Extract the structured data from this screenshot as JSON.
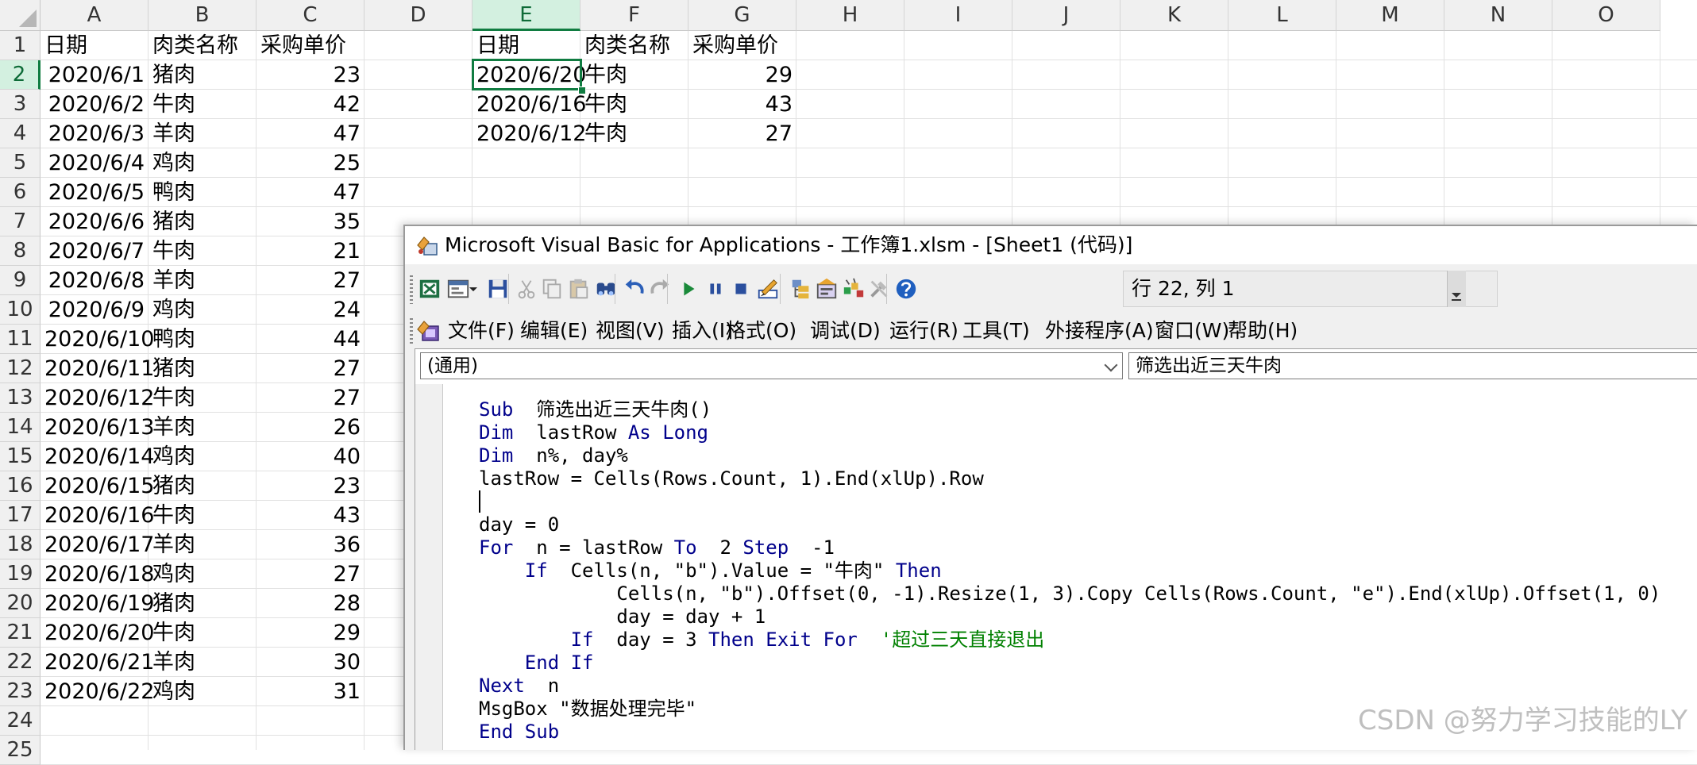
{
  "sheet": {
    "columns": [
      "A",
      "B",
      "C",
      "D",
      "E",
      "F",
      "G",
      "H",
      "I",
      "J",
      "K",
      "L",
      "M",
      "N",
      "O"
    ],
    "rows": [
      "1",
      "2",
      "3",
      "4",
      "5",
      "6",
      "7",
      "8",
      "9",
      "10",
      "11",
      "12",
      "13",
      "14",
      "15",
      "16",
      "17",
      "18",
      "19",
      "20",
      "21",
      "22",
      "23",
      "24",
      "25"
    ],
    "table_left": {
      "headers": [
        "日期",
        "肉类名称",
        "采购单价"
      ],
      "rows": [
        [
          "2020/6/1",
          "猪肉",
          "23"
        ],
        [
          "2020/6/2",
          "牛肉",
          "42"
        ],
        [
          "2020/6/3",
          "羊肉",
          "47"
        ],
        [
          "2020/6/4",
          "鸡肉",
          "25"
        ],
        [
          "2020/6/5",
          "鸭肉",
          "47"
        ],
        [
          "2020/6/6",
          "猪肉",
          "35"
        ],
        [
          "2020/6/7",
          "牛肉",
          "21"
        ],
        [
          "2020/6/8",
          "羊肉",
          "27"
        ],
        [
          "2020/6/9",
          "鸡肉",
          "24"
        ],
        [
          "2020/6/10",
          "鸭肉",
          "44"
        ],
        [
          "2020/6/11",
          "猪肉",
          "27"
        ],
        [
          "2020/6/12",
          "牛肉",
          "27"
        ],
        [
          "2020/6/13",
          "羊肉",
          "26"
        ],
        [
          "2020/6/14",
          "鸡肉",
          "40"
        ],
        [
          "2020/6/15",
          "猪肉",
          "23"
        ],
        [
          "2020/6/16",
          "牛肉",
          "43"
        ],
        [
          "2020/6/17",
          "羊肉",
          "36"
        ],
        [
          "2020/6/18",
          "鸡肉",
          "27"
        ],
        [
          "2020/6/19",
          "猪肉",
          "28"
        ],
        [
          "2020/6/20",
          "牛肉",
          "29"
        ],
        [
          "2020/6/21",
          "羊肉",
          "30"
        ],
        [
          "2020/6/22",
          "鸡肉",
          "31"
        ]
      ]
    },
    "table_right": {
      "headers": [
        "日期",
        "肉类名称",
        "采购单价"
      ],
      "rows": [
        [
          "2020/6/20",
          "牛肉",
          "29"
        ],
        [
          "2020/6/16",
          "牛肉",
          "43"
        ],
        [
          "2020/6/12",
          "牛肉",
          "27"
        ]
      ]
    },
    "selected_column": "E",
    "selected_row": "2",
    "accent_color": "#107c41"
  },
  "vba": {
    "title": "Microsoft Visual Basic for Applications - 工作簿1.xlsm - [Sheet1 (代码)]",
    "status": "行 22, 列 1",
    "menu": [
      "文件(F)",
      "编辑(E)",
      "视图(V)",
      "插入(I)",
      "格式(O)",
      "调试(D)",
      "运行(R)",
      "工具(T)",
      "外接程序(A)",
      "窗口(W)",
      "帮助(H)"
    ],
    "toolbar_icons": [
      "excel-view-icon",
      "insert-module-icon",
      "dropdown-arrow-icon",
      "save-icon",
      "cut-icon",
      "copy-icon",
      "paste-icon",
      "find-icon",
      "undo-icon",
      "redo-icon",
      "run-icon",
      "break-icon",
      "reset-icon",
      "design-mode-icon",
      "project-explorer-icon",
      "properties-icon",
      "object-browser-icon",
      "toolbox-icon",
      "help-icon"
    ],
    "object_combo": "(通用)",
    "procedure_combo": "筛选出近三天牛肉",
    "code": [
      [
        [
          "kw",
          "Sub"
        ],
        [
          "",
          "  筛选出近三天牛肉()"
        ]
      ],
      [
        [
          "kw",
          "Dim"
        ],
        [
          "",
          "  lastRow "
        ],
        [
          "kw",
          "As Long"
        ]
      ],
      [
        [
          "kw",
          "Dim"
        ],
        [
          "",
          "  n%, day%"
        ]
      ],
      [
        [
          "",
          "lastRow = Cells(Rows.Count, 1).End(xlUp).Row"
        ]
      ],
      [
        [
          "",
          ""
        ]
      ],
      [
        [
          "",
          "day = 0"
        ]
      ],
      [
        [
          "kw",
          "For"
        ],
        [
          "",
          "  n = lastRow "
        ],
        [
          "kw",
          "To"
        ],
        [
          "",
          "  2 "
        ],
        [
          "kw",
          "Step"
        ],
        [
          "",
          "  -1"
        ]
      ],
      [
        [
          "",
          "    "
        ],
        [
          "kw",
          "If"
        ],
        [
          "",
          "  Cells(n, \"b\").Value = \"牛肉\" "
        ],
        [
          "kw",
          "Then"
        ]
      ],
      [
        [
          "",
          "            Cells(n, \"b\").Offset(0, -1).Resize(1, 3).Copy Cells(Rows.Count, \"e\").End(xlUp).Offset(1, 0)"
        ]
      ],
      [
        [
          "",
          "            day = day + 1"
        ]
      ],
      [
        [
          "",
          "        "
        ],
        [
          "kw",
          "If"
        ],
        [
          "",
          "  day = 3 "
        ],
        [
          "kw",
          "Then Exit For"
        ],
        [
          "cm",
          "  '超过三天直接退出"
        ]
      ],
      [
        [
          "",
          "    "
        ],
        [
          "kw",
          "End If"
        ]
      ],
      [
        [
          "kw",
          "Next"
        ],
        [
          "",
          "  n"
        ]
      ],
      [
        [
          "",
          "MsgBox \"数据处理完毕\""
        ]
      ],
      [
        [
          "kw",
          "End Sub"
        ]
      ]
    ]
  },
  "watermark": "CSDN @努力学习技能的LY"
}
